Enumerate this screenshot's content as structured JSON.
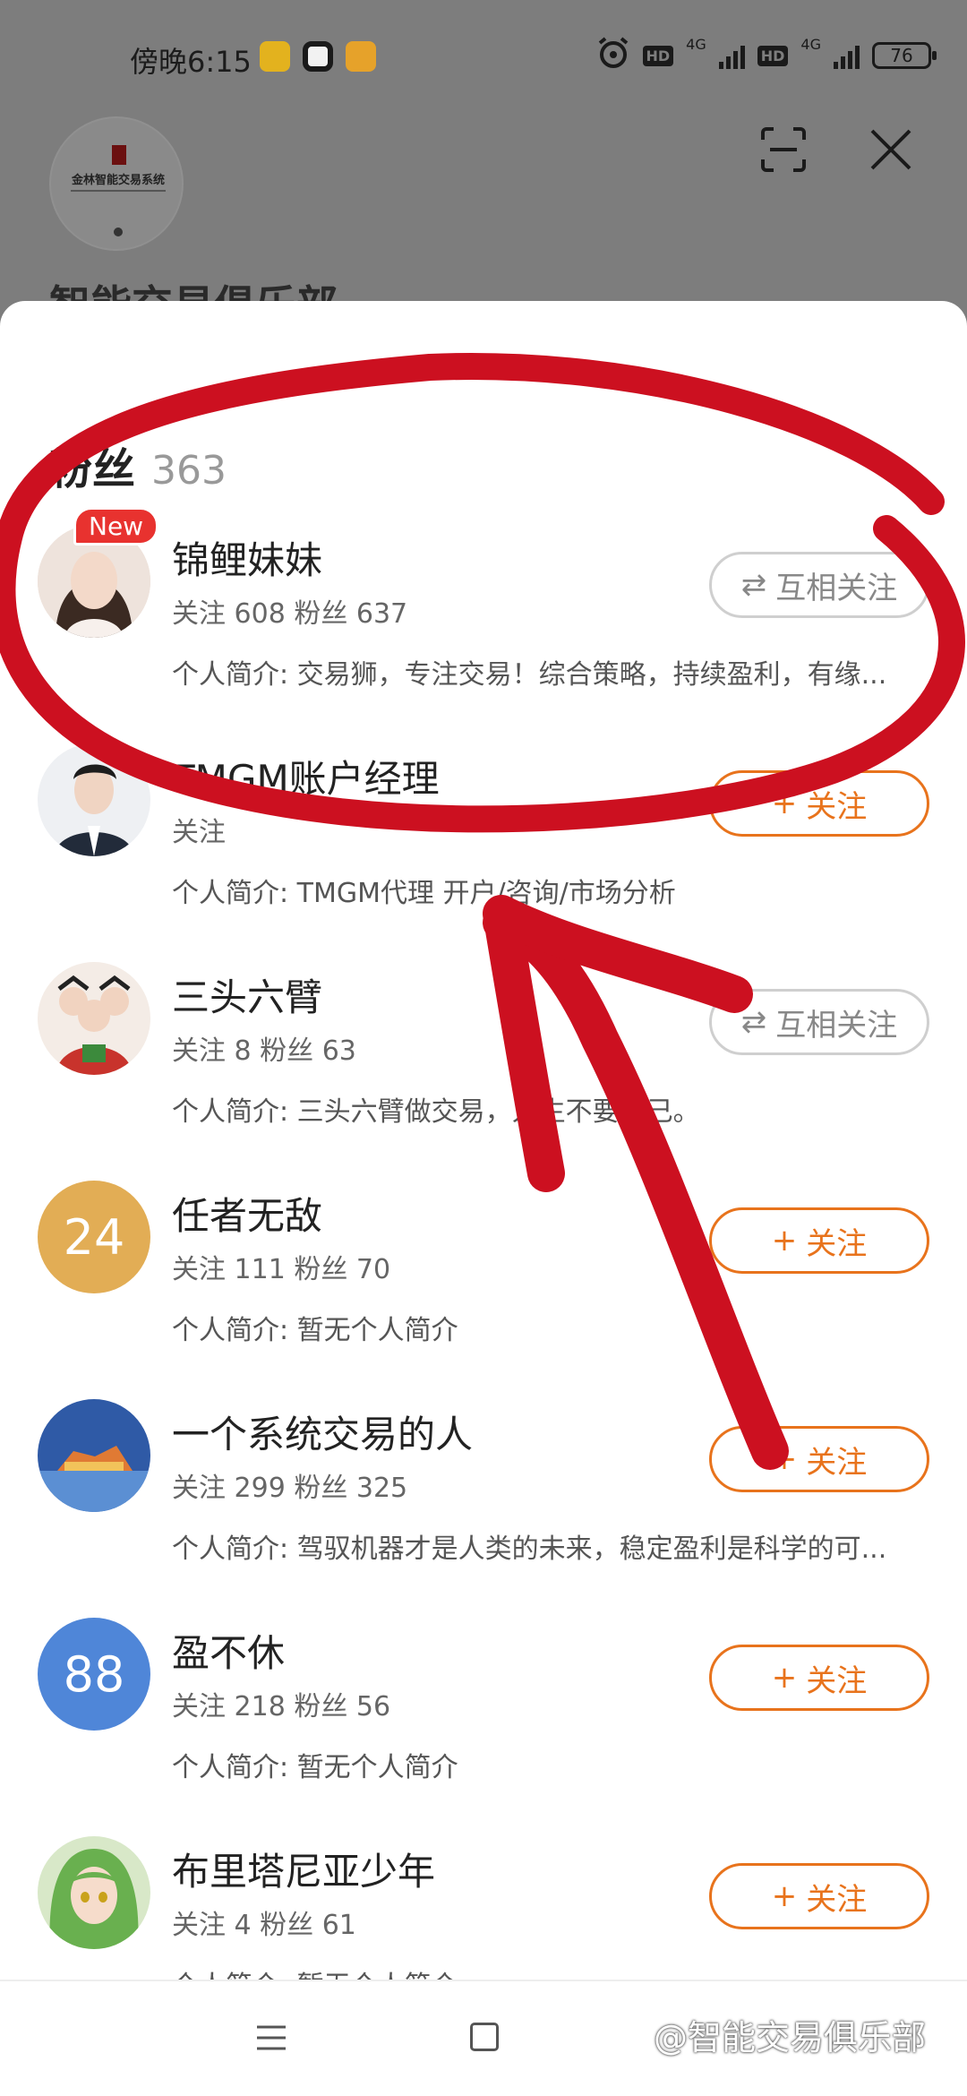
{
  "status_bar": {
    "time": "傍晚6:15",
    "network_1": "4G",
    "network_2": "4G",
    "hd_1": "HD",
    "hd_2": "HD",
    "battery": "76"
  },
  "background_page": {
    "logo_text": "金林智能交易系统",
    "club_name": "智能交易俱乐部"
  },
  "sheet": {
    "title": "粉丝",
    "count": "363"
  },
  "followers": [
    {
      "name": "锦鲤妹妹",
      "stats": "关注 608 粉丝 637",
      "bio": "个人简介: 交易狮，专注交易！综合策略，持续盈利，有缘...",
      "button": "互相关注",
      "button_icon": "⇄",
      "button_type": "mutual",
      "badge": "New",
      "avatar_color": "#e8d6cc"
    },
    {
      "name": "TMGM账户经理",
      "stats": "关注",
      "bio": "个人简介: TMGM代理 开户/咨询/市场分析",
      "button": "关注",
      "button_icon": "+",
      "button_type": "add",
      "badge": "",
      "avatar_color": "#eef0f3"
    },
    {
      "name": "三头六臂",
      "stats": "关注 8 粉丝 63",
      "bio": "个人简介: 三头六臂做交易，人生不要自己。",
      "button": "互相关注",
      "button_icon": "⇄",
      "button_type": "mutual",
      "badge": "",
      "avatar_color": "#f2e9e4"
    },
    {
      "name": "任者无敌",
      "stats": "关注 111 粉丝 70",
      "bio": "个人简介: 暂无个人简介",
      "button": "关注",
      "button_icon": "+",
      "button_type": "add",
      "badge": "",
      "avatar_color": "#e2ad55",
      "avatar_text": "24"
    },
    {
      "name": "一个系统交易的人",
      "stats": "关注 299 粉丝 325",
      "bio": "个人简介: 驾驭机器才是人类的未来，稳定盈利是科学的可...",
      "button": "关注",
      "button_icon": "+",
      "button_type": "add",
      "badge": "",
      "avatar_color": "#3a63a8"
    },
    {
      "name": "盈不休",
      "stats": "关注 218 粉丝 56",
      "bio": "个人简介: 暂无个人简介",
      "button": "关注",
      "button_icon": "+",
      "button_type": "add",
      "badge": "",
      "avatar_color": "#4f86d8",
      "avatar_text": "88"
    },
    {
      "name": "布里塔尼亚少年",
      "stats": "关注 4 粉丝 61",
      "bio": "个人简介: 暂无个人简介",
      "button": "关注",
      "button_icon": "+",
      "button_type": "add",
      "badge": "",
      "avatar_color": "#7fb36a"
    }
  ],
  "watermark": "@智能交易俱乐部",
  "colors": {
    "accent_orange": "#e8731c",
    "badge_red": "#e8322f",
    "annotation_red": "#cc1020"
  }
}
